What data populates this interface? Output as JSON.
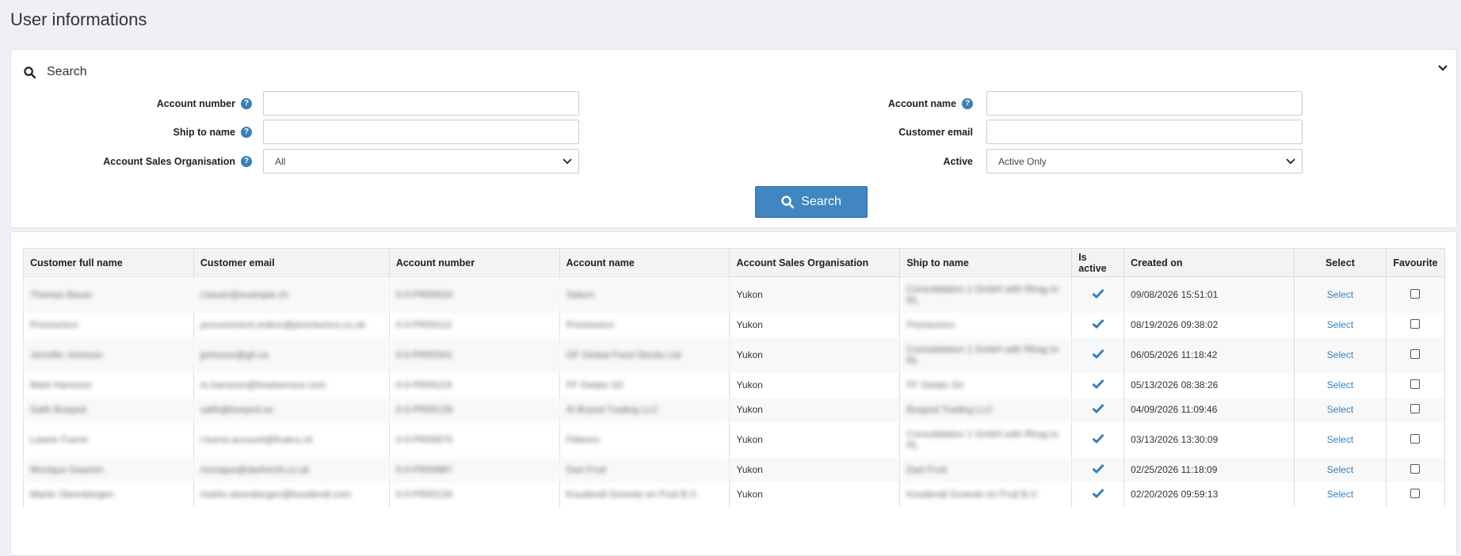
{
  "page": {
    "title": "User informations"
  },
  "search": {
    "title": "Search",
    "account_number_label": "Account number",
    "ship_to_name_label": "Ship to name",
    "sales_org_label": "Account Sales Organisation",
    "sales_org_value": "All",
    "account_name_label": "Account name",
    "customer_email_label": "Customer email",
    "active_label": "Active",
    "active_value": "Active Only",
    "search_button": "Search"
  },
  "table": {
    "headers": [
      "Customer full name",
      "Customer email",
      "Account number",
      "Account name",
      "Account Sales Organisation",
      "Ship to name",
      "Is active",
      "Created on",
      "Select",
      "Favourite"
    ],
    "rows": [
      {
        "name": "Thomas Bauer",
        "email": "t.bauer@example.ch",
        "account_number": "0-0-PR00024",
        "account_name": "Saturn",
        "sales_org": "Yukon",
        "ship_to": "Consolidation 1 GmbH with Rtrag to RL",
        "created": "09/08/2026 15:51:01",
        "select": "Select"
      },
      {
        "name": "Premiumco",
        "email": "procurement.orders@premiumco.co.uk",
        "account_number": "0-0-PR00112",
        "account_name": "Premiumco",
        "sales_org": "Yukon",
        "ship_to": "Premiumco",
        "created": "08/19/2026 09:38:02",
        "select": "Select"
      },
      {
        "name": "Jennifer Johnson",
        "email": "jjohnson@gh.ca",
        "account_number": "0-0-PR00341",
        "account_name": "GF Global Food Stocks Ltd",
        "sales_org": "Yukon",
        "ship_to": "Consolidation 1 GmbH with Rtrag to RL",
        "created": "06/05/2026 11:18:42",
        "select": "Select"
      },
      {
        "name": "Mark Hansson",
        "email": "m.hansson@foodservice.com",
        "account_number": "0-0-PR00119",
        "account_name": "FF Gelato Srl",
        "sales_org": "Yukon",
        "ship_to": "FF Gelato Srl",
        "created": "05/13/2026 08:38:26",
        "select": "Select"
      },
      {
        "name": "Salih Boayed",
        "email": "salih@boayed.se",
        "account_number": "0-0-PR00129",
        "account_name": "Al Boyed Trading LLC",
        "sales_org": "Yukon",
        "ship_to": "Boayed Trading LLC",
        "created": "04/09/2026 11:09:46",
        "select": "Select"
      },
      {
        "name": "Lawrie Fuerst",
        "email": "l.fuerst.account@fruitco.ch",
        "account_number": "0-0-PR00870",
        "account_name": "Fildvers",
        "sales_org": "Yukon",
        "ship_to": "Consolidation 1 GmbH with Rtrag to RL",
        "created": "03/13/2026 13:30:09",
        "select": "Select"
      },
      {
        "name": "Monique Gaarton",
        "email": "monique@darfrecht.co.uk",
        "account_number": "0-0-PR00887",
        "account_name": "Dart Fruit",
        "sales_org": "Yukon",
        "ship_to": "Dart Fruit",
        "created": "02/25/2026 11:18:09",
        "select": "Select"
      },
      {
        "name": "Martin Steenbergen",
        "email": "martin.steenbergen@koudendl.com",
        "account_number": "0-0-PR00134",
        "account_name": "Koudendl Groente en Fruit B.V.",
        "sales_org": "Yukon",
        "ship_to": "Koudendl Groente en Fruit B.V.",
        "created": "02/20/2026 09:59:13",
        "select": "Select"
      }
    ]
  },
  "colors": {
    "accent": "#3f86c2",
    "link": "#3a7fb8",
    "check": "#3a7fb8"
  }
}
